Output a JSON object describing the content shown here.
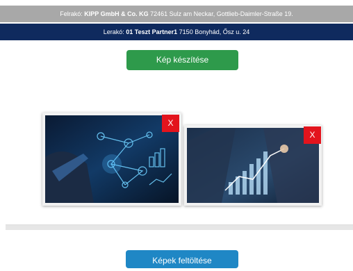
{
  "header": {
    "pickup": {
      "label": "Felrakó:",
      "company": "KIPP GmbH & Co. KG",
      "address": "72461 Sulz am Neckar, Gottlieb-Daimler-Straße 19."
    },
    "dropoff": {
      "label": "Lerakó:",
      "company": "01 Teszt Partner1",
      "address": "7150 Bonyhád, Ősz u. 24"
    }
  },
  "actions": {
    "capture_label": "Kép készítése",
    "upload_label": "Képek feltöltése"
  },
  "photos": [
    {
      "delete_label": "X"
    },
    {
      "delete_label": "X"
    }
  ],
  "colors": {
    "pickup_bar": "#a8a8a8",
    "dropoff_bar": "#0f2a5e",
    "capture_button": "#2e9a4b",
    "upload_button": "#1f87c5",
    "delete_button": "#e3141d"
  }
}
